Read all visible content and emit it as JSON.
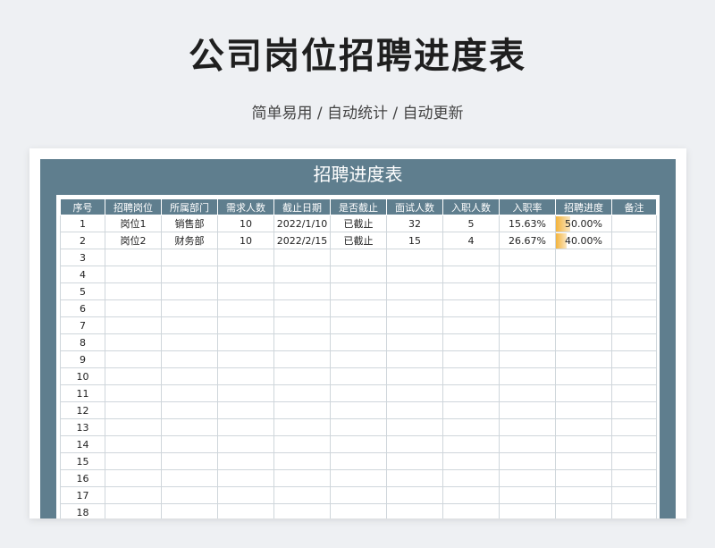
{
  "header": {
    "title": "公司岗位招聘进度表",
    "subtitle": "简单易用  /  自动统计  /  自动更新"
  },
  "sheet": {
    "title": "招聘进度表",
    "columns": [
      "序号",
      "招聘岗位",
      "所属部门",
      "需求人数",
      "截止日期",
      "是否截止",
      "面试人数",
      "入职人数",
      "入职率",
      "招聘进度",
      "备注"
    ],
    "rows": [
      {
        "index": "1",
        "position": "岗位1",
        "department": "销售部",
        "demand": "10",
        "deadline": "2022/1/10",
        "closed": "已截止",
        "interviews": "32",
        "hired": "5",
        "hire_rate": "15.63%",
        "progress": "50.00%",
        "progress_fraction": 0.5,
        "note": ""
      },
      {
        "index": "2",
        "position": "岗位2",
        "department": "财务部",
        "demand": "10",
        "deadline": "2022/2/15",
        "closed": "已截止",
        "interviews": "15",
        "hired": "4",
        "hire_rate": "26.67%",
        "progress": "40.00%",
        "progress_fraction": 0.4,
        "note": ""
      },
      {
        "index": "3"
      },
      {
        "index": "4"
      },
      {
        "index": "5"
      },
      {
        "index": "6"
      },
      {
        "index": "7"
      },
      {
        "index": "8"
      },
      {
        "index": "9"
      },
      {
        "index": "10"
      },
      {
        "index": "11"
      },
      {
        "index": "12"
      },
      {
        "index": "13"
      },
      {
        "index": "14"
      },
      {
        "index": "15"
      },
      {
        "index": "16"
      },
      {
        "index": "17"
      },
      {
        "index": "18"
      }
    ]
  },
  "colors": {
    "header_bg": "#5f7e8e",
    "progress_bar": "#f3b33c",
    "page_bg": "#eef0f3"
  }
}
